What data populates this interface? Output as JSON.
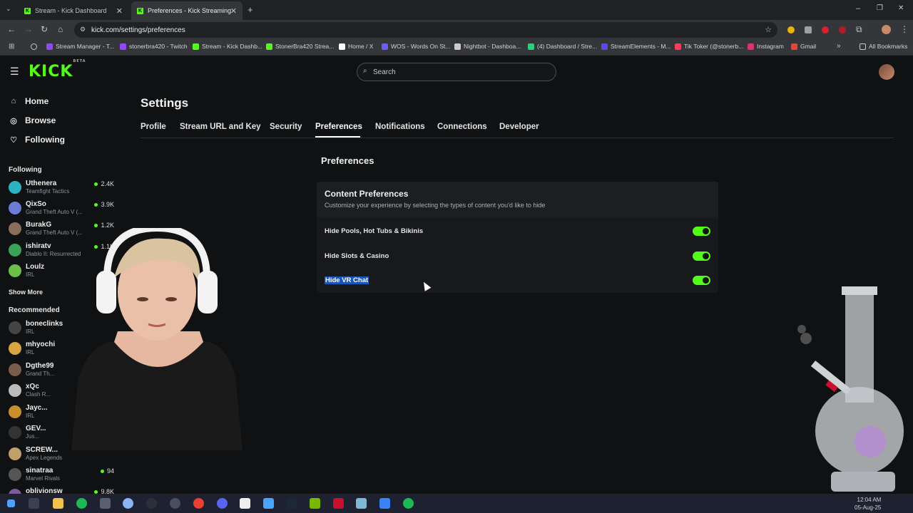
{
  "browser": {
    "tabs": [
      {
        "label": "Stream - Kick Dashboard",
        "active": false
      },
      {
        "label": "Preferences - Kick Streaming",
        "active": true
      }
    ],
    "url": "kick.com/settings/preferences",
    "bookmarks": [
      {
        "label": "Stream Manager - T...",
        "color": "#9146ff"
      },
      {
        "label": "stonerbra420 - Twitch",
        "color": "#9146ff"
      },
      {
        "label": "Stream - Kick Dashb...",
        "color": "#53fc18"
      },
      {
        "label": "StonerBra420 Strea...",
        "color": "#53fc18"
      },
      {
        "label": "Home / X",
        "color": "#ffffff"
      },
      {
        "label": "WOS - Words On St...",
        "color": "#6a5cff"
      },
      {
        "label": "Nightbot - Dashboa...",
        "color": "#cccccc"
      },
      {
        "label": "(4) Dashboard / Stre...",
        "color": "#2bd07a"
      },
      {
        "label": "StreamElements - M...",
        "color": "#5a49f5"
      },
      {
        "label": "Tik Toker (@stonerb...",
        "color": "#ff3b5c"
      },
      {
        "label": "Instagram",
        "color": "#e1306c"
      },
      {
        "label": "Gmail",
        "color": "#ea4335"
      }
    ],
    "all_bookmarks": "All Bookmarks"
  },
  "topnav": {
    "logo": "KICK",
    "logo_badge": "BETA",
    "search_placeholder": "Search"
  },
  "sidebar": {
    "main": [
      {
        "label": "Home",
        "icon": "home-icon"
      },
      {
        "label": "Browse",
        "icon": "compass-icon"
      },
      {
        "label": "Following",
        "icon": "heart-icon"
      }
    ],
    "following_heading": "Following",
    "following": [
      {
        "name": "Uthenera",
        "game": "Teamfight Tactics",
        "viewers": "2.4K",
        "color": "#2bb3c0"
      },
      {
        "name": "QixSo",
        "game": "Grand Theft Auto V (...",
        "viewers": "3.9K",
        "color": "#6b7bd6"
      },
      {
        "name": "BurakG",
        "game": "Grand Theft Auto V (...",
        "viewers": "1.2K",
        "color": "#8a6d5a"
      },
      {
        "name": "ishiratv",
        "game": "Diablo II: Resurrected",
        "viewers": "1.1K",
        "color": "#3aa35a"
      },
      {
        "name": "Loulz",
        "game": "IRL",
        "viewers": "",
        "color": "#6cc04a"
      }
    ],
    "show_more": "Show More",
    "recommended_heading": "Recommended",
    "recommended": [
      {
        "name": "boneclinks",
        "game": "IRL",
        "viewers": "",
        "color": "#444"
      },
      {
        "name": "mhyochi",
        "game": "IRL",
        "viewers": "",
        "color": "#d9a441"
      },
      {
        "name": "Dgthe99",
        "game": "Grand Th...",
        "viewers": "",
        "color": "#7a5c4a"
      },
      {
        "name": "xQc",
        "game": "Clash R...",
        "viewers": "",
        "color": "#bbbbbb"
      },
      {
        "name": "Jayc...",
        "game": "IRL",
        "viewers": "",
        "color": "#c7902a"
      },
      {
        "name": "GEV...",
        "game": "Jus...",
        "viewers": "",
        "color": "#333"
      },
      {
        "name": "SCREW...",
        "game": "Apex Legends",
        "viewers": "",
        "color": "#c0a06a"
      },
      {
        "name": "sinatraa",
        "game": "Marvel Rivals",
        "viewers": "94",
        "color": "#555"
      },
      {
        "name": "oblivionsw",
        "game": "",
        "viewers": "9.8K",
        "color": "#7d5a9a"
      }
    ]
  },
  "settings": {
    "title": "Settings",
    "tabs": [
      "Profile",
      "Stream URL and Key",
      "Security",
      "Preferences",
      "Notifications",
      "Connections",
      "Developer"
    ],
    "active_tab": "Preferences",
    "section_title": "Preferences",
    "card": {
      "title": "Content Preferences",
      "subtitle": "Customize your experience by selecting the types of content you'd like to hide",
      "rows": [
        {
          "label": "Hide Pools, Hot Tubs & Bikinis",
          "enabled": true
        },
        {
          "label": "Hide Slots & Casino",
          "enabled": true
        },
        {
          "label": "Hide VR Chat",
          "enabled": true
        }
      ]
    }
  },
  "taskbar": {
    "time": "12:04 AM",
    "date": "05-Aug-25"
  },
  "colors": {
    "accent": "#53fc18",
    "background": "#0f1113",
    "card": "#17191c",
    "selection": "#1c55b8"
  }
}
